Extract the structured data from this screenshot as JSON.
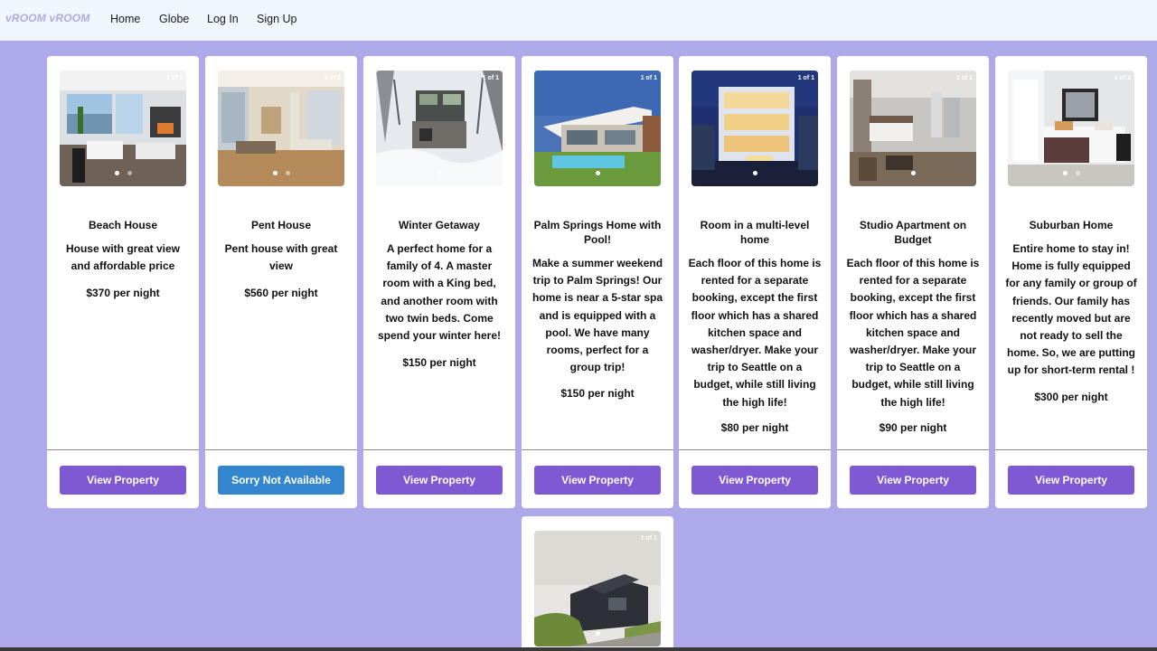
{
  "nav": {
    "brand": "vROOM vROOM",
    "links": [
      "Home",
      "Globe",
      "Log In",
      "Sign Up"
    ]
  },
  "colors": {
    "background": "#aeaaea",
    "navbar": "#f1f6fc",
    "button_primary": "#7f59d4",
    "button_unavailable": "#3385cf"
  },
  "properties": [
    {
      "title": "Beach House",
      "description": "House with great view and affordable price",
      "price": "$370 per night",
      "image_counter": "1 of 2",
      "image": "beach-house-photo",
      "button": "View Property"
    },
    {
      "title": "Pent House",
      "description": "Pent house with great view",
      "price": "$560 per night",
      "image_counter": "1 of 2",
      "image": "penthouse-photo",
      "button": "Sorry Not Available"
    },
    {
      "title": "Winter Getaway",
      "description": "A perfect home for a family of 4. A master room with a King bed, and another room with two twin beds. Come spend your winter here!",
      "price": "$150 per night",
      "image_counter": "1 of 1",
      "image": "winter-cabin-photo",
      "button": "View Property"
    },
    {
      "title": "Palm Springs Home with Pool!",
      "description": "Make a summer weekend trip to Palm Springs! Our home is near a 5-star spa and is equipped with a pool. We have many rooms, perfect for a group trip!",
      "price": "$150 per night",
      "image_counter": "1 of 1",
      "image": "pool-house-photo",
      "button": "View Property"
    },
    {
      "title": "Room in a multi-level home",
      "description": "Each floor of this home is rented for a separate booking, except the first floor which has a shared kitchen space and washer/dryer. Make your trip to Seattle on a budget, while still living the high life!",
      "price": "$80 per night",
      "image_counter": "1 of 1",
      "image": "multi-level-home-photo",
      "button": "View Property"
    },
    {
      "title": "Studio Apartment on Budget",
      "description": "Each floor of this home is rented for a separate booking, except the first floor which has a shared kitchen space and washer/dryer. Make your trip to Seattle on a budget, while still living the high life!",
      "price": "$90 per night",
      "image_counter": "1 of 1",
      "image": "studio-apartment-photo",
      "button": "View Property"
    },
    {
      "title": "Suburban Home",
      "description": "Entire home to stay in! Home is fully equipped for any family or group of friends. Our family has recently moved but are not ready to sell the home. So, we are putting up for short-term rental !",
      "price": "$300 per night",
      "image_counter": "1 of 2",
      "image": "bedroom-photo",
      "button": "View Property"
    },
    {
      "image_counter": "1 of 1",
      "image": "modern-hillside-house-photo"
    }
  ]
}
